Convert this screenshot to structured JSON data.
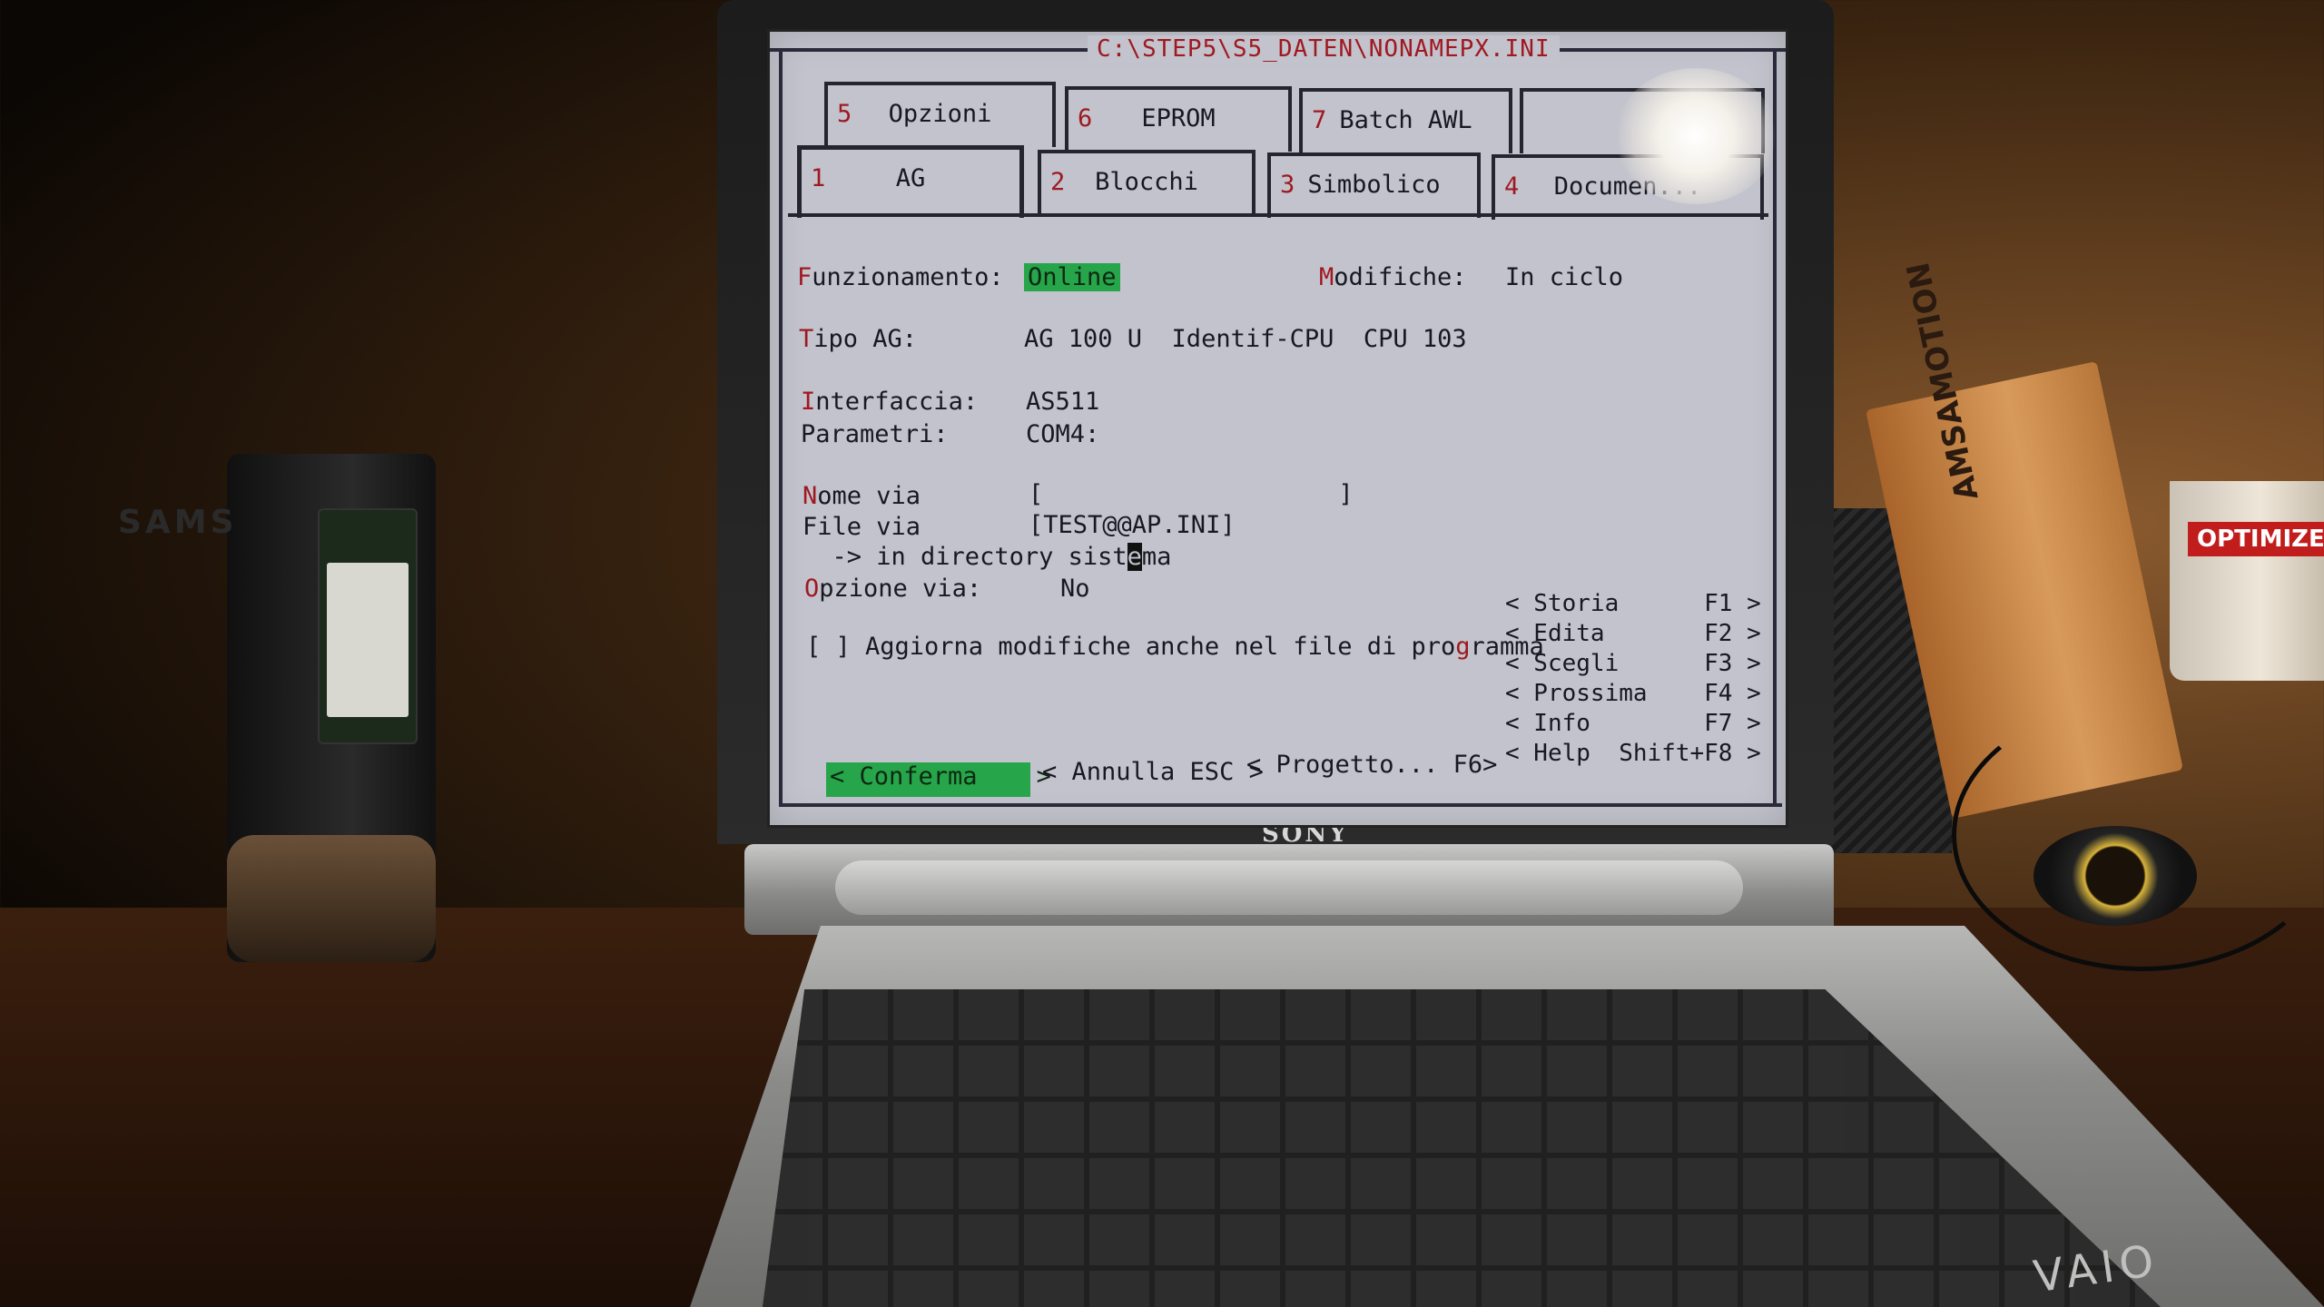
{
  "window": {
    "title": "C:\\STEP5\\S5_DATEN\\NONAMEPX.INI"
  },
  "tabs_back": [
    {
      "num": "5",
      "label": "Opzioni"
    },
    {
      "num": "6",
      "label": "EPROM"
    },
    {
      "num": "7",
      "label": "Batch AWL"
    }
  ],
  "tabs_front": [
    {
      "num": "1",
      "label": "AG"
    },
    {
      "num": "2",
      "label": "Blocchi"
    },
    {
      "num": "3",
      "label": "Simbolico"
    },
    {
      "num": "4",
      "label": "Documen..."
    }
  ],
  "form": {
    "funzionamento_label_hot": "F",
    "funzionamento_label_rest": "unzionamento:",
    "funzionamento_value": "Online",
    "modifiche_label_hot": "M",
    "modifiche_label_rest": "odifiche:",
    "modifiche_value": "In ciclo",
    "tipo_ag_label_hot": "T",
    "tipo_ag_label_rest": "ipo AG:",
    "tipo_ag_value": "AG 100 U  Identif-CPU  CPU 103",
    "interfaccia_label_hot": "I",
    "interfaccia_label_rest": "nterfaccia:",
    "interfaccia_value": "AS511",
    "parametri_label_hot": "P",
    "parametri_label_rest": "arametri:",
    "parametri_value": "COM4:",
    "nome_via_label_hot": "N",
    "nome_via_label_rest": "ome via",
    "nome_via_value": "[                    ]",
    "file_via_label": "File via",
    "file_via_value": "[TEST@@AP.INI]",
    "directory_pre": "  -> in directory sist",
    "directory_cursor": "e",
    "directory_post": "ma",
    "opzione_via_label_hot": "O",
    "opzione_via_label_rest": "pzione via:",
    "opzione_via_value": "No",
    "checkbox_text_pre": "[ ] Aggiorna modifiche anche nel file di pro",
    "checkbox_hot": "g",
    "checkbox_text_post": "ramma"
  },
  "side_menu": [
    {
      "label": "< Storia      F1 >"
    },
    {
      "label": "< Edita       F2 >"
    },
    {
      "label": "< Scegli      F3 >"
    },
    {
      "label": "< Prossima    F4 >"
    },
    {
      "label": "< Info        F7 >"
    },
    {
      "label": "< Help  Shift+F8 >"
    }
  ],
  "buttons": {
    "conferma": "< Conferma    >",
    "annulla": "< Annulla ESC >",
    "progetto": "< Progetto... F6>"
  },
  "surroundings": {
    "laptop_brand": "SONY",
    "laptop_logo": "VAIO",
    "box_text": "AMSAMOTION",
    "mug_text": "OPTIMIZE",
    "dock_text": "SAMS"
  }
}
